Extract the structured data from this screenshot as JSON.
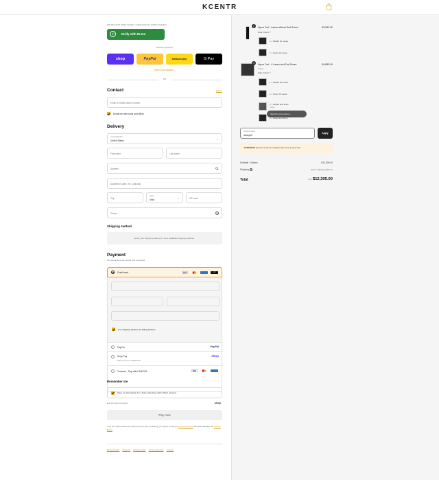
{
  "header": {
    "logo": "KCENTR"
  },
  "idme": {
    "note": "10% discount for military members, medical personnel, and first responders",
    "button": "Verify with ID.me"
  },
  "express": {
    "title": "Express checkout",
    "shop": "shop",
    "paypal": "PayPal",
    "amazon": "amazon pay",
    "gpay": "G Pay",
    "more": "Show more options",
    "or": "OR"
  },
  "contact": {
    "title": "Contact",
    "signin": "Sign in",
    "placeholder": "Email or mobile phone number",
    "news": "Email me with news and offers"
  },
  "delivery": {
    "title": "Delivery",
    "country_label": "Country/Region",
    "country_value": "United States",
    "first": "First name",
    "last": "Last name",
    "address": "Address",
    "apt": "Apartment, suite, etc. (optional)",
    "city": "City",
    "state_label": "State",
    "state_value": "Iowa",
    "zip": "ZIP code",
    "phone": "Phone"
  },
  "shipping": {
    "title": "Shipping method",
    "msg": "Enter your shipping address to view available shipping methods."
  },
  "payment": {
    "title": "Payment",
    "sub": "All transactions are secure and encrypted.",
    "credit": "Credit card",
    "billing": "Use shipping address as billing address",
    "paypal": "PayPal",
    "paypal_logo": "PayPal",
    "shoppay": "Shop Pay",
    "shoppay_sub": "Pay in full or in installments",
    "shop_logo": "shop",
    "truemed": "Truemed - Pay with HSA/FSA"
  },
  "remember": {
    "title": "Remember me",
    "save": "Save my information for a faster checkout with a Shop account",
    "secure": "Secure and encrypted",
    "shop_logo": "shop"
  },
  "paynow": "Pay now",
  "terms": {
    "pre": "Your info will be saved to a Shop account. By continuing, you agree to Shop's",
    "tos": "Terms of Service",
    "mid": "and acknowledge the",
    "privacy": "Privacy Policy",
    "end": "."
  },
  "footer": {
    "links": [
      "Refund policy",
      "Shipping",
      "Privacy policy",
      "Terms of service",
      "Contact"
    ]
  },
  "cart": {
    "item1": {
      "qty": "1",
      "name": "Hyrox Turf - Lanes without End Zones",
      "price": "$3,590.00",
      "toggle": "Hide 2 items",
      "subs": [
        "1 × Middle 10 Lanes",
        "1 × Outer 10 Lanes"
      ]
    },
    "item2": {
      "qty": "1",
      "name": "Hyrox Turf - 4 Lanes and End Zones",
      "variant": "Yellow",
      "price": "$4,885.00",
      "toggle": "Hide 4 items",
      "subs": [
        "1 × Middle 10 Lanes",
        "1 × Outer 10 Lanes",
        "1 × Middle End Zone",
        "1 × Outer End Zone"
      ],
      "sub3_note": "Yellow"
    },
    "scroll_hint": "Scroll for more items",
    "discount_label": "Discount code",
    "discount_value": "strong10",
    "apply": "Apply",
    "error_code": "STRONG10",
    "error_msg": "discount code isn't valid for the items in your cart",
    "subtotal_label": "Subtotal · 6 items",
    "subtotal": "$12,305.00",
    "shipping_label": "Shipping",
    "shipping_value": "Enter shipping address",
    "total_label": "Total",
    "currency": "USD",
    "total": "$12,305.00"
  },
  "colors": {
    "accent": "#e2ae0b",
    "shop": "#5a31f4",
    "paypal": "#ffc439",
    "amazon": "#ffd814",
    "idme": "#2e8b3e"
  }
}
